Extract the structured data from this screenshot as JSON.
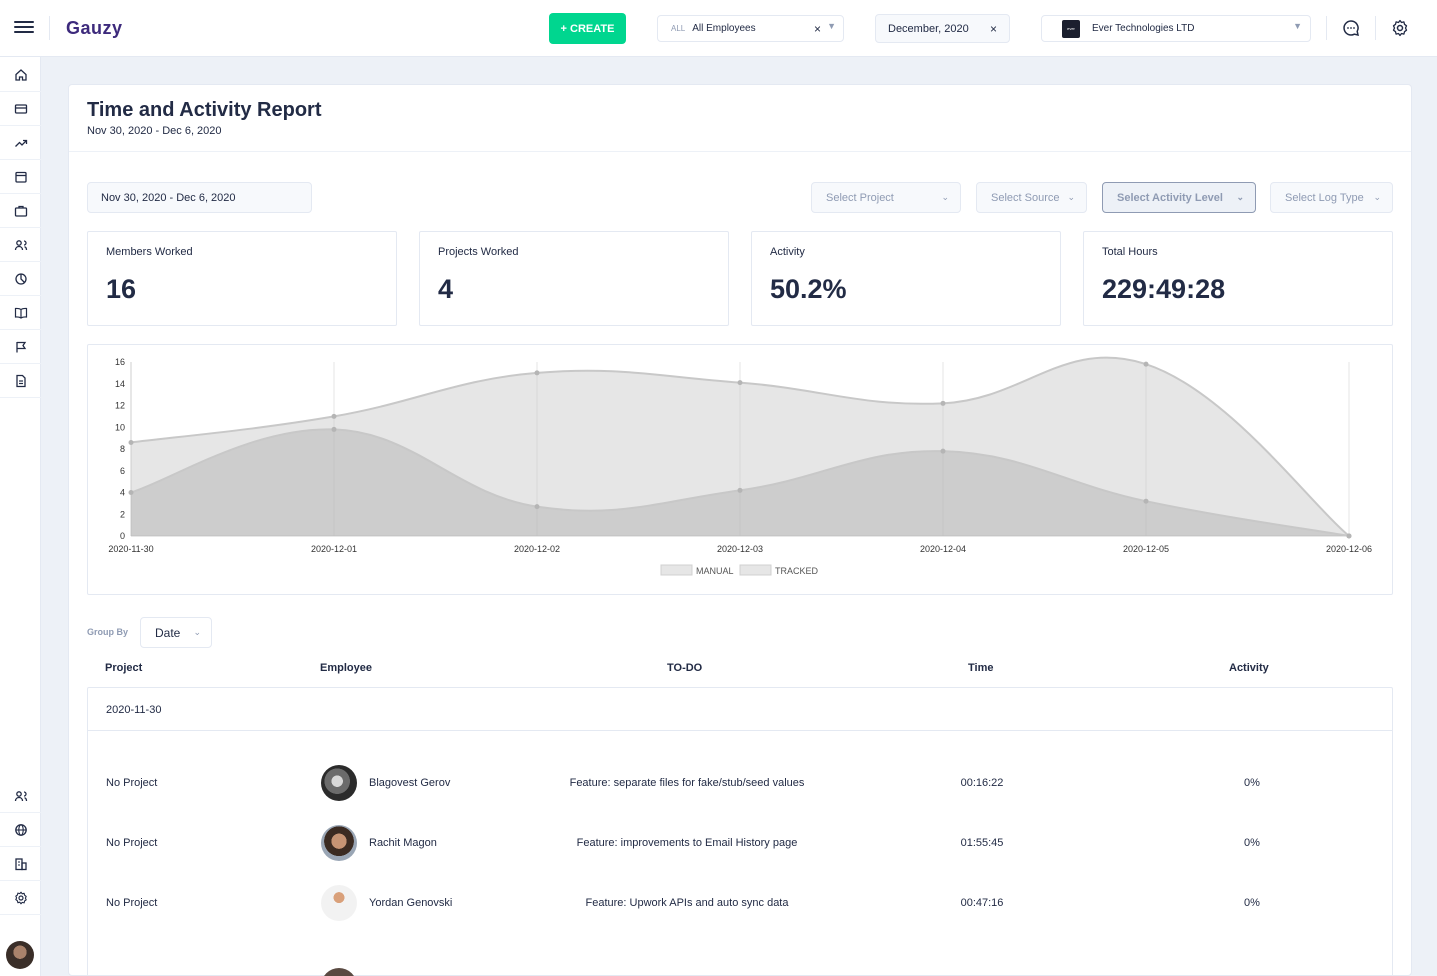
{
  "header": {
    "logo_text": "Gauzy",
    "create_label": "+ CREATE",
    "employee_filter": {
      "prefix": "ALL",
      "value": "All Employees"
    },
    "date_filter": "December, 2020",
    "organization": {
      "logo_text": "ever",
      "name": "Ever Technologies LTD"
    },
    "icons": [
      "menu-icon",
      "chat-icon",
      "gear-icon"
    ]
  },
  "sidebar": {
    "top_icons": [
      "home-icon",
      "card-icon",
      "trending-icon",
      "calendar-icon",
      "briefcase-icon",
      "people-icon",
      "pie-icon",
      "book-icon",
      "flag-icon",
      "file-icon"
    ],
    "bottom_icons": [
      "people-icon",
      "globe-icon",
      "building-icon",
      "settings-icon"
    ]
  },
  "report": {
    "title": "Time and Activity Report",
    "subtitle": "Nov 30, 2020 - Dec 6, 2020",
    "date_range": "Nov 30, 2020 - Dec 6, 2020",
    "filters": {
      "project": "Select Project",
      "source": "Select Source",
      "activity_level": "Select Activity Level",
      "log_type": "Select Log Type"
    },
    "stats": [
      {
        "label": "Members Worked",
        "value": "16"
      },
      {
        "label": "Projects Worked",
        "value": "4"
      },
      {
        "label": "Activity",
        "value": "50.2%"
      },
      {
        "label": "Total Hours",
        "value": "229:49:28"
      }
    ],
    "group_by_label": "Group By",
    "group_by_value": "Date",
    "columns": {
      "project": "Project",
      "employee": "Employee",
      "todo": "TO-DO",
      "time": "Time",
      "activity": "Activity"
    },
    "group_date": "2020-11-30",
    "rows": [
      {
        "project": "No Project",
        "employee": "Blagovest Gerov",
        "todo": "Feature: separate files for fake/stub/seed values",
        "time": "00:16:22",
        "activity": "0%"
      },
      {
        "project": "No Project",
        "employee": "Rachit Magon",
        "todo": "Feature: improvements to Email History page",
        "time": "01:55:45",
        "activity": "0%"
      },
      {
        "project": "No Project",
        "employee": "Yordan Genovski",
        "todo": "Feature: Upwork APIs and auto sync data",
        "time": "00:47:16",
        "activity": "0%"
      }
    ]
  },
  "chart_data": {
    "type": "area",
    "x": [
      "2020-11-30",
      "2020-12-01",
      "2020-12-02",
      "2020-12-03",
      "2020-12-04",
      "2020-12-05",
      "2020-12-06"
    ],
    "yticks": [
      0,
      2,
      4,
      6,
      8,
      10,
      12,
      14,
      16
    ],
    "ylim": [
      0,
      16
    ],
    "series": [
      {
        "name": "MANUAL",
        "values": [
          4,
          9.8,
          2.7,
          4.2,
          7.8,
          3.2,
          0
        ]
      },
      {
        "name": "TRACKED",
        "values": [
          8.6,
          11,
          15,
          14.1,
          12.2,
          15.8,
          0
        ]
      }
    ],
    "legend_position": "bottom",
    "grid": "vertical"
  }
}
